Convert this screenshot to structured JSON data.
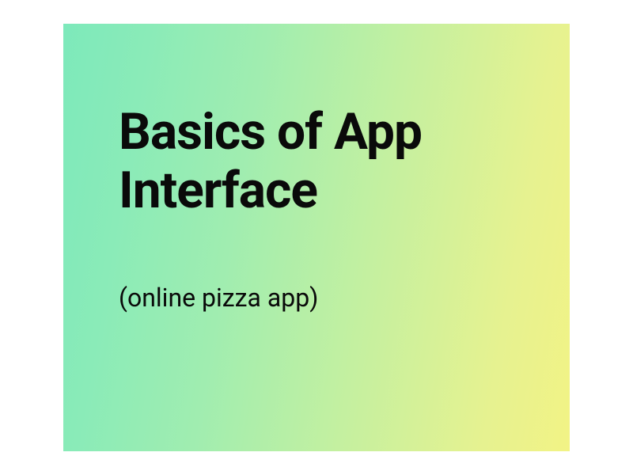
{
  "slide": {
    "title": "Basics of App Interface",
    "subtitle": "(online pizza app)"
  }
}
